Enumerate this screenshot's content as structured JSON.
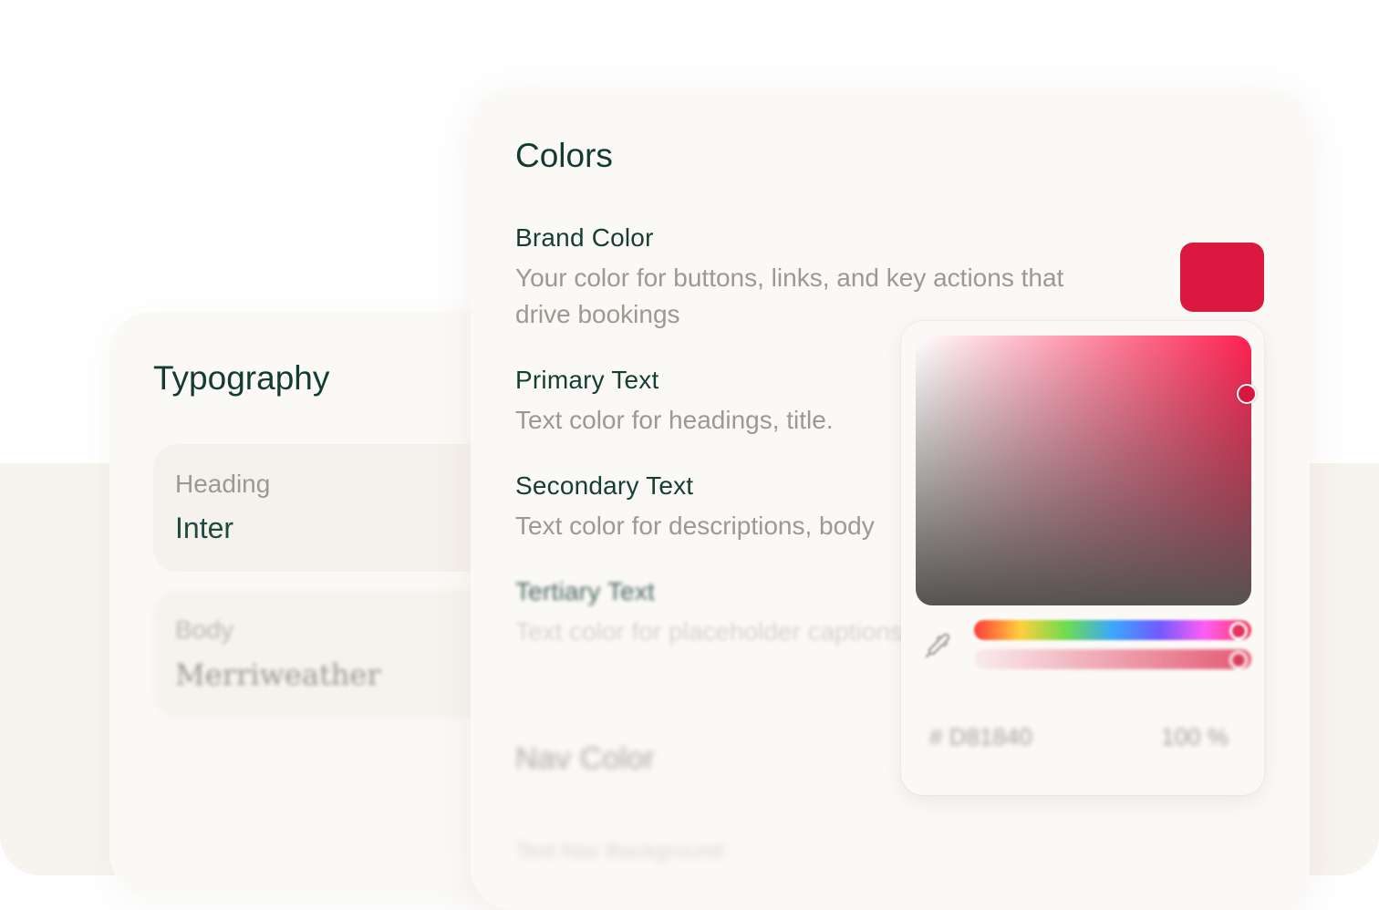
{
  "typography": {
    "title": "Typography",
    "fonts": [
      {
        "label": "Heading",
        "value": "Inter"
      },
      {
        "label": "Body",
        "value": "Merriweather"
      }
    ]
  },
  "colors": {
    "title": "Colors",
    "items": [
      {
        "title": "Brand Color",
        "description": "Your color for buttons, links, and key actions that drive bookings"
      },
      {
        "title": "Primary Text",
        "description": "Text color for headings, title."
      },
      {
        "title": "Secondary Text",
        "description": "Text color for descriptions, body"
      },
      {
        "title": "Tertiary Text",
        "description": "Text color for placeholder captions"
      },
      {
        "title": "Nav Color",
        "description": ""
      },
      {
        "title": "",
        "description": "Text Nav Background"
      }
    ],
    "brand_swatch": "#DA1840"
  },
  "picker": {
    "hex_value": "# D81840",
    "alpha_value": "100 %",
    "hue_color": "#FF1F4F",
    "eyedropper_icon": "eyedropper-icon"
  }
}
